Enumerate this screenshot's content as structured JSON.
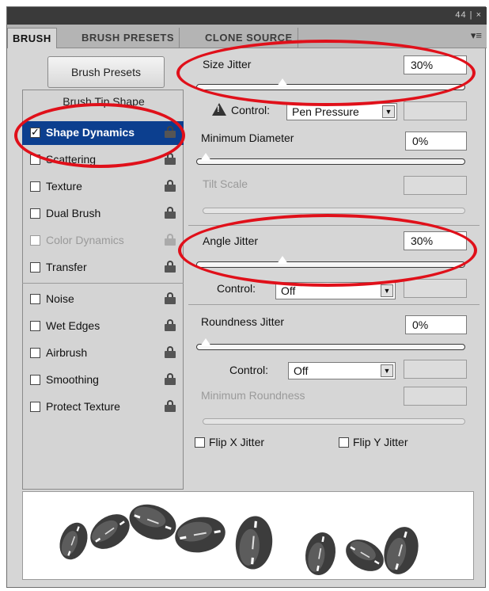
{
  "window": {
    "controls": "44 | ×"
  },
  "tabs": [
    {
      "label": "BRUSH",
      "active": true
    },
    {
      "label": "BRUSH PRESETS",
      "active": false
    },
    {
      "label": "CLONE SOURCE",
      "active": false
    }
  ],
  "tab_menu": "▾≡",
  "brush_presets_button": "Brush Presets",
  "left_panel": {
    "header": "Brush Tip Shape",
    "items": [
      {
        "label": "Shape Dynamics",
        "checked": true,
        "selected": true,
        "enabled": true
      },
      {
        "label": "Scattering",
        "checked": false,
        "selected": false,
        "enabled": true
      },
      {
        "label": "Texture",
        "checked": false,
        "selected": false,
        "enabled": true
      },
      {
        "label": "Dual Brush",
        "checked": false,
        "selected": false,
        "enabled": true
      },
      {
        "label": "Color Dynamics",
        "checked": false,
        "selected": false,
        "enabled": false
      },
      {
        "label": "Transfer",
        "checked": false,
        "selected": false,
        "enabled": true
      },
      {
        "label": "Noise",
        "checked": false,
        "selected": false,
        "enabled": true
      },
      {
        "label": "Wet Edges",
        "checked": false,
        "selected": false,
        "enabled": true
      },
      {
        "label": "Airbrush",
        "checked": false,
        "selected": false,
        "enabled": true
      },
      {
        "label": "Smoothing",
        "checked": false,
        "selected": false,
        "enabled": true
      },
      {
        "label": "Protect Texture",
        "checked": false,
        "selected": false,
        "enabled": true
      }
    ]
  },
  "settings": {
    "size_jitter": {
      "label": "Size Jitter",
      "value": "30%",
      "level": 0.3
    },
    "size_control": {
      "label": "Control:",
      "value": "Pen Pressure"
    },
    "minimum_diameter": {
      "label": "Minimum Diameter",
      "value": "0%",
      "level": 0
    },
    "tilt_scale": {
      "label": "Tilt Scale"
    },
    "angle_jitter": {
      "label": "Angle Jitter",
      "value": "30%",
      "level": 0.3
    },
    "angle_control": {
      "label": "Control:",
      "value": "Off"
    },
    "roundness_jitter": {
      "label": "Roundness Jitter",
      "value": "0%",
      "level": 0
    },
    "roundness_control": {
      "label": "Control:",
      "value": "Off"
    },
    "minimum_roundness": {
      "label": "Minimum Roundness"
    },
    "flip_x": {
      "label": "Flip X Jitter",
      "checked": false
    },
    "flip_y": {
      "label": "Flip Y Jitter",
      "checked": false
    }
  },
  "colors": {
    "annotation": "#e0101a",
    "selection": "#0c3f8f",
    "panel": "#d6d6d6"
  },
  "preview": {
    "brush_icon": "football-brush-stroke"
  }
}
